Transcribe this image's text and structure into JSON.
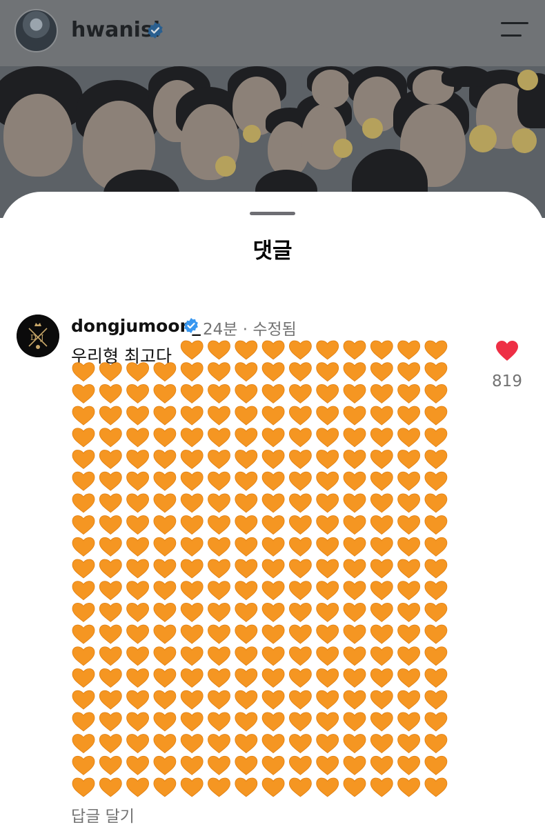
{
  "header": {
    "username": "hwanisi",
    "verified": true,
    "menu_icon": "hamburger-menu-icon"
  },
  "sheet": {
    "title": "댓글"
  },
  "comment": {
    "username": "dongjumoon_",
    "verified": true,
    "meta": "24분 · 수정됨",
    "text": "우리형 최고다",
    "emoji": "orange-heart",
    "heart_rows": 21,
    "first_row_hearts": 10,
    "hearts_per_row": 14,
    "like_icon": "heart-filled-icon",
    "like_count": "819",
    "reply_label": "답글 달기"
  },
  "colors": {
    "verified_blue": "#3897f0",
    "orange_heart": "#f59622",
    "like_red": "#ee2f45",
    "meta_gray": "#737373"
  }
}
